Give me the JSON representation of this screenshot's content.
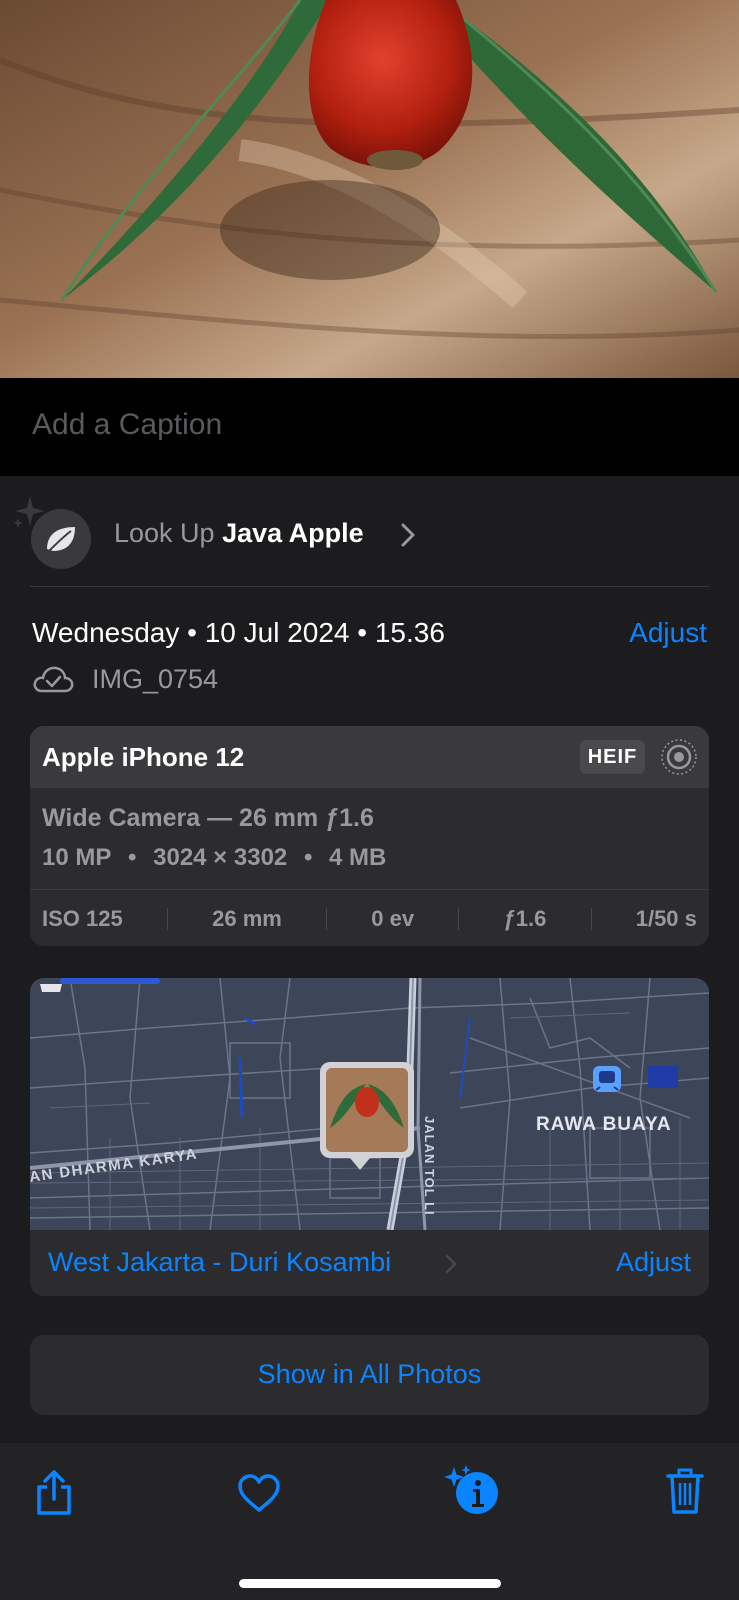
{
  "caption": {
    "placeholder": "Add a Caption"
  },
  "lookup": {
    "prefix": "Look Up",
    "subject": "Java Apple"
  },
  "meta": {
    "date": "Wednesday • 10 Jul 2024 • 15.36",
    "adjust_label": "Adjust",
    "filename": "IMG_0754"
  },
  "camera": {
    "model": "Apple iPhone 12",
    "format": "HEIF",
    "lens": "Wide Camera — 26 mm ƒ1.6",
    "megapixels": "10 MP",
    "resolution": "3024 × 3302",
    "size": "4 MB",
    "iso": "ISO 125",
    "focal": "26 mm",
    "ev": "0 ev",
    "aperture": "ƒ1.6",
    "shutter": "1/50 s"
  },
  "map": {
    "area_label": "RAWA BUAYA",
    "road_label": "AN DHARMA KARYA",
    "toll_label": "JALAN TOL LI",
    "location": "West Jakarta - Duri Kosambi",
    "adjust_label": "Adjust"
  },
  "show_all_label": "Show in All Photos",
  "colors": {
    "accent": "#0a84ff",
    "background": "#1c1c1e",
    "card": "#2c2c2e"
  },
  "toolbar": {
    "icons": [
      "share-icon",
      "heart-icon",
      "visual-lookup-info-icon",
      "trash-icon"
    ]
  }
}
